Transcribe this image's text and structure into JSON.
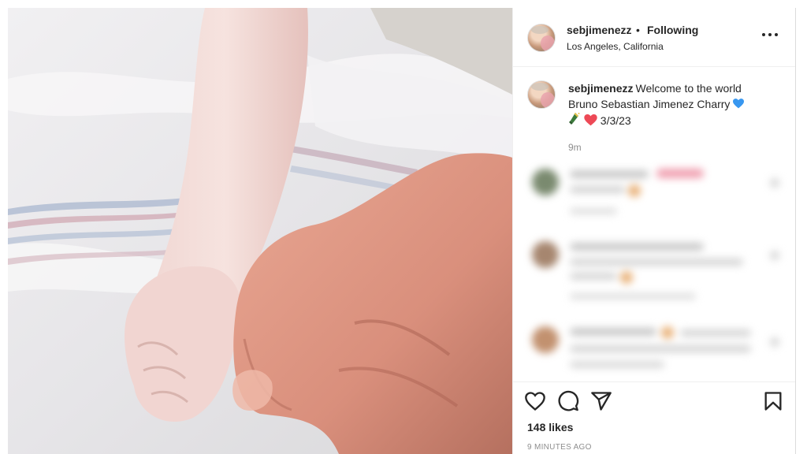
{
  "post": {
    "username": "sebjimenezz",
    "separator": "•",
    "follow_status": "Following",
    "location": "Los Angeles, California",
    "caption": {
      "username": "sebjimenezz",
      "line1": "Welcome to the world",
      "line2": "Bruno Sebastian Jimenez Charry",
      "date": "3/3/23",
      "emojis": [
        "blue-heart",
        "champagne",
        "red-heart"
      ]
    },
    "caption_time": "9m",
    "likes": "148 likes",
    "posted_ago": "9 MINUTES AGO"
  },
  "icons": {
    "more": "more-options-icon",
    "like": "heart-outline-icon",
    "comment": "comment-bubble-icon",
    "share": "paper-plane-icon",
    "save": "bookmark-icon"
  },
  "colors": {
    "text": "#262626",
    "muted": "#8e8e8e",
    "border": "#efefef",
    "blue_heart": "#3897f0",
    "red_heart": "#ed4956"
  }
}
